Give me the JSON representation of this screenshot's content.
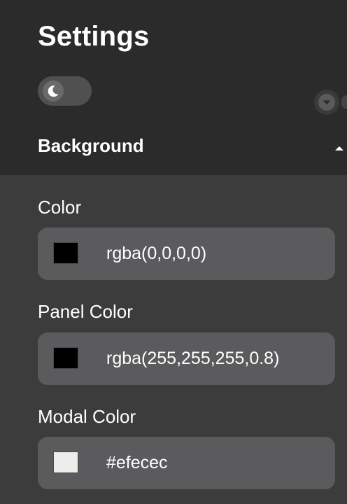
{
  "header": {
    "title": "Settings"
  },
  "theme_toggle": {
    "icon": "moon-icon",
    "state": "dark"
  },
  "section": {
    "title": "Background",
    "expanded": true
  },
  "fields": [
    {
      "label": "Color",
      "value": "rgba(0,0,0,0)",
      "swatch_color": "#000000"
    },
    {
      "label": "Panel Color",
      "value": "rgba(255,255,255,0.8)",
      "swatch_color": "#000000"
    },
    {
      "label": "Modal Color",
      "value": "#efecec",
      "swatch_color": "#efecec"
    }
  ],
  "colors": {
    "header_bg": "#2b2b2b",
    "body_bg": "#3c3c3c",
    "field_bg": "#5b5b5d"
  }
}
